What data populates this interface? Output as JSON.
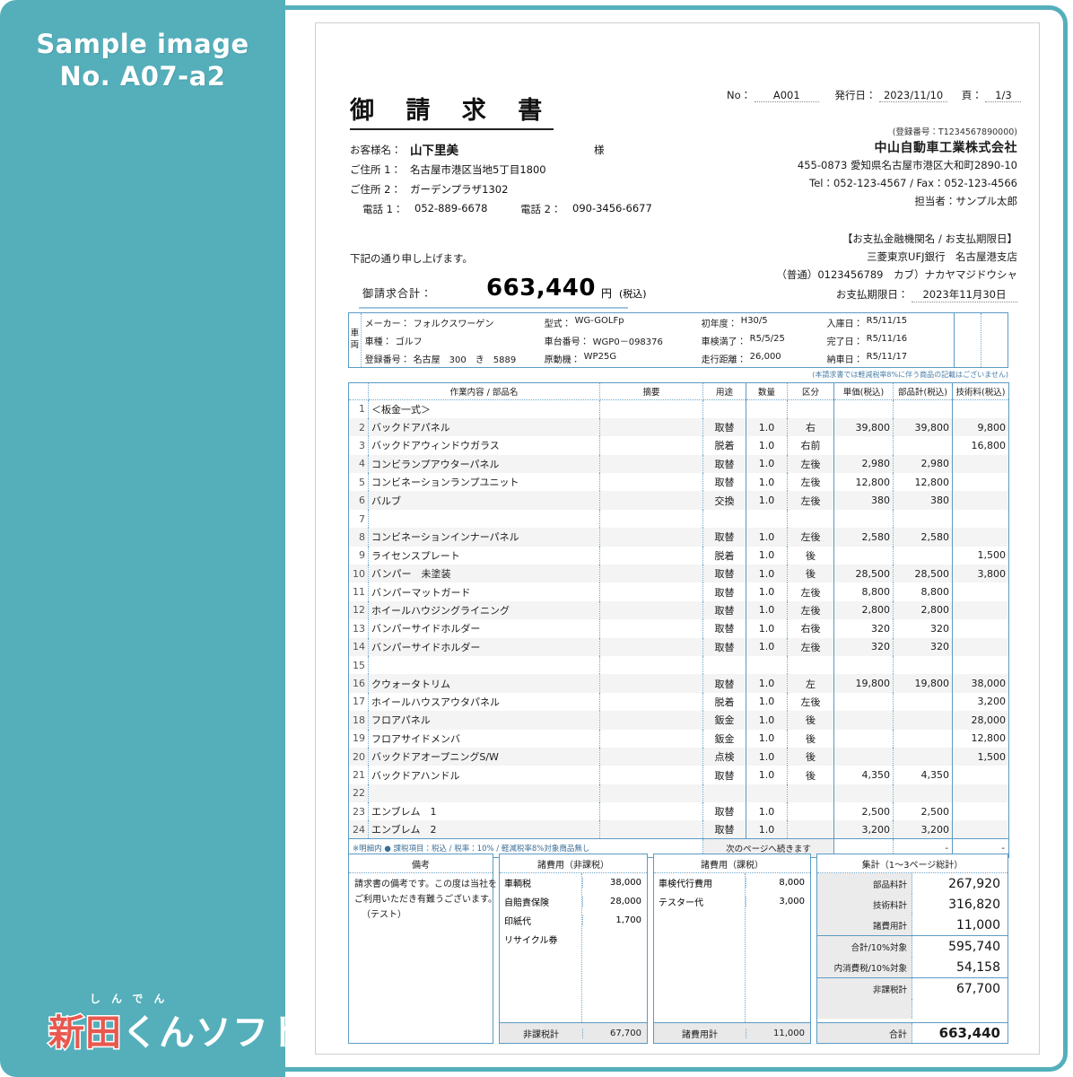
{
  "banner": {
    "title": "Sample image",
    "subtitle": "No. A07-a2",
    "logo_ruby": "しんでん",
    "logo_red": "新田",
    "logo_white": "くんソフト",
    "bg_color": "#54afbb"
  },
  "header": {
    "invoice_title": "御 請 求 書",
    "no_label": "No：",
    "no_value": "A001",
    "issue_label": "発行日：",
    "issue_value": "2023/11/10",
    "page_label": "頁：",
    "page_value": "1/3"
  },
  "customer": {
    "name_label": "お客様名：",
    "name_value": "山下里美",
    "honorific": "様",
    "addr1_label": "ご住所 1：",
    "addr1_value": "名古屋市港区当地5丁目1800",
    "addr2_label": "ご住所 2：",
    "addr2_value": "ガーデンプラザ1302",
    "tel1_label": "電話 1：",
    "tel1_value": "052-889-6678",
    "tel2_label": "電話 2：",
    "tel2_value": "090-3456-6677"
  },
  "company": {
    "registration": "(登録番号：T1234567890000)",
    "name": "中山自動車工業株式会社",
    "address": "455-0873  愛知県名古屋市港区大和町2890-10",
    "telfax": "Tel：052-123-4567  /  Fax：052-123-4566",
    "contact": "担当者：サンプル太郎"
  },
  "payment": {
    "heading": "【お支払金融機関名 / お支払期限日】",
    "bank": "三菱東京UFJ銀行　名古屋港支店",
    "account": "（普通）0123456789　カブ）ナカヤマジドウシャ",
    "due_label": "お支払期限日：",
    "due_value": "2023年11月30日"
  },
  "total": {
    "lead": "下記の通り申し上げます。",
    "label": "御請求合計：",
    "amount": "663,440",
    "yen": "円",
    "taxnote": "(税込)"
  },
  "vehicle": {
    "side_label_1": "車",
    "side_label_2": "両",
    "note": "(本請求書では軽減税率8%に伴う商品の記載はございません)",
    "fields": [
      {
        "k": "メーカー：",
        "v": "フォルクスワーゲン"
      },
      {
        "k": "型式：",
        "v": "WG-GOLFp"
      },
      {
        "k": "初年度：",
        "v": "H30/5"
      },
      {
        "k": "入庫日：",
        "v": "R5/11/15"
      },
      {
        "k": "車種：",
        "v": "ゴルフ"
      },
      {
        "k": "車台番号：",
        "v": "WGP0－098376"
      },
      {
        "k": "車検満了：",
        "v": "R5/5/25"
      },
      {
        "k": "完了日：",
        "v": "R5/11/16"
      },
      {
        "k": "登録番号：",
        "v": "名古屋　300　き　5889"
      },
      {
        "k": "原動機：",
        "v": "WP25G"
      },
      {
        "k": "走行距離：",
        "v": "26,000"
      },
      {
        "k": "納車日：",
        "v": "R5/11/17"
      }
    ]
  },
  "table": {
    "headers": [
      "",
      "作業内容 / 部品名",
      "摘要",
      "用途",
      "数量",
      "区分",
      "単価(税込)",
      "部品計(税込)",
      "技術料(税込)"
    ],
    "rows": [
      {
        "no": "1",
        "name": "＜板金一式＞",
        "remark": "",
        "use": "",
        "qty": "",
        "div": "",
        "unit": "",
        "part": "",
        "tech": ""
      },
      {
        "no": "2",
        "name": "バックドアパネル",
        "remark": "",
        "use": "取替",
        "qty": "1.0",
        "div": "右",
        "unit": "39,800",
        "part": "39,800",
        "tech": "9,800"
      },
      {
        "no": "3",
        "name": "バックドアウィンドウガラス",
        "remark": "",
        "use": "脱着",
        "qty": "1.0",
        "div": "右前",
        "unit": "",
        "part": "",
        "tech": "16,800"
      },
      {
        "no": "4",
        "name": "コンビランプアウターパネル",
        "remark": "",
        "use": "取替",
        "qty": "1.0",
        "div": "左後",
        "unit": "2,980",
        "part": "2,980",
        "tech": ""
      },
      {
        "no": "5",
        "name": "コンビネーションランプユニット",
        "remark": "",
        "use": "取替",
        "qty": "1.0",
        "div": "左後",
        "unit": "12,800",
        "part": "12,800",
        "tech": ""
      },
      {
        "no": "6",
        "name": "バルブ",
        "remark": "",
        "use": "交換",
        "qty": "1.0",
        "div": "左後",
        "unit": "380",
        "part": "380",
        "tech": ""
      },
      {
        "no": "7",
        "name": "",
        "remark": "",
        "use": "",
        "qty": "",
        "div": "",
        "unit": "",
        "part": "",
        "tech": ""
      },
      {
        "no": "8",
        "name": "コンビネーションインナーパネル",
        "remark": "",
        "use": "取替",
        "qty": "1.0",
        "div": "左後",
        "unit": "2,580",
        "part": "2,580",
        "tech": ""
      },
      {
        "no": "9",
        "name": "ライセンスプレート",
        "remark": "",
        "use": "脱着",
        "qty": "1.0",
        "div": "後",
        "unit": "",
        "part": "",
        "tech": "1,500"
      },
      {
        "no": "10",
        "name": "バンパー　未塗装",
        "remark": "",
        "use": "取替",
        "qty": "1.0",
        "div": "後",
        "unit": "28,500",
        "part": "28,500",
        "tech": "3,800"
      },
      {
        "no": "11",
        "name": "バンパーマットガード",
        "remark": "",
        "use": "取替",
        "qty": "1.0",
        "div": "左後",
        "unit": "8,800",
        "part": "8,800",
        "tech": ""
      },
      {
        "no": "12",
        "name": "ホイールハウジングライニング",
        "remark": "",
        "use": "取替",
        "qty": "1.0",
        "div": "左後",
        "unit": "2,800",
        "part": "2,800",
        "tech": ""
      },
      {
        "no": "13",
        "name": "バンパーサイドホルダー",
        "remark": "",
        "use": "取替",
        "qty": "1.0",
        "div": "右後",
        "unit": "320",
        "part": "320",
        "tech": ""
      },
      {
        "no": "14",
        "name": "バンパーサイドホルダー",
        "remark": "",
        "use": "取替",
        "qty": "1.0",
        "div": "左後",
        "unit": "320",
        "part": "320",
        "tech": ""
      },
      {
        "no": "15",
        "name": "",
        "remark": "",
        "use": "",
        "qty": "",
        "div": "",
        "unit": "",
        "part": "",
        "tech": ""
      },
      {
        "no": "16",
        "name": "クウォータトリム",
        "remark": "",
        "use": "取替",
        "qty": "1.0",
        "div": "左",
        "unit": "19,800",
        "part": "19,800",
        "tech": "38,000"
      },
      {
        "no": "17",
        "name": "ホイールハウスアウタパネル",
        "remark": "",
        "use": "脱着",
        "qty": "1.0",
        "div": "左後",
        "unit": "",
        "part": "",
        "tech": "3,200"
      },
      {
        "no": "18",
        "name": "フロアパネル",
        "remark": "",
        "use": "鈑金",
        "qty": "1.0",
        "div": "後",
        "unit": "",
        "part": "",
        "tech": "28,000"
      },
      {
        "no": "19",
        "name": "フロアサイドメンバ",
        "remark": "",
        "use": "鈑金",
        "qty": "1.0",
        "div": "後",
        "unit": "",
        "part": "",
        "tech": "12,800"
      },
      {
        "no": "20",
        "name": "バックドアオープニングS/W",
        "remark": "",
        "use": "点検",
        "qty": "1.0",
        "div": "後",
        "unit": "",
        "part": "",
        "tech": "1,500"
      },
      {
        "no": "21",
        "name": "バックドアハンドル",
        "remark": "",
        "use": "取替",
        "qty": "1.0",
        "div": "後",
        "unit": "4,350",
        "part": "4,350",
        "tech": ""
      },
      {
        "no": "22",
        "name": "",
        "remark": "",
        "use": "",
        "qty": "",
        "div": "",
        "unit": "",
        "part": "",
        "tech": ""
      },
      {
        "no": "23",
        "name": "エンブレム　1",
        "remark": "",
        "use": "取替",
        "qty": "1.0",
        "div": "",
        "unit": "2,500",
        "part": "2,500",
        "tech": ""
      },
      {
        "no": "24",
        "name": "エンブレム　2",
        "remark": "",
        "use": "取替",
        "qty": "1.0",
        "div": "",
        "unit": "3,200",
        "part": "3,200",
        "tech": ""
      }
    ],
    "footer_note": "※明細内 ● 課税項目：税込 / 税率：10% / 軽減税率8%対象商品無し",
    "footer_continue": "次のページへ続きます",
    "footer_part_total": "-",
    "footer_tech_total": "-"
  },
  "remarks_box": {
    "title": "備考",
    "lines": [
      "請求書の備考です。この度は当社を",
      "ご利用いただき有難うございます。",
      "（テスト）"
    ]
  },
  "nontax_box": {
    "title": "諸費用（非課税）",
    "rows": [
      {
        "name": "車輌税",
        "amount": "38,000"
      },
      {
        "name": "自賠責保険",
        "amount": "28,000"
      },
      {
        "name": "印紙代",
        "amount": "1,700"
      },
      {
        "name": "リサイクル券",
        "amount": ""
      }
    ],
    "total_label": "非課税計",
    "total_amount": "67,700"
  },
  "tax_box": {
    "title": "諸費用（課税）",
    "rows": [
      {
        "name": "車検代行費用",
        "amount": "8,000"
      },
      {
        "name": "テスター代",
        "amount": "3,000"
      }
    ],
    "total_label": "諸費用計",
    "total_amount": "11,000"
  },
  "summary_box": {
    "title": "集計（1～3ページ総計）",
    "group1": [
      {
        "label": "部品料計",
        "value": "267,920"
      },
      {
        "label": "技術料計",
        "value": "316,820"
      },
      {
        "label": "諸費用計",
        "value": "11,000"
      }
    ],
    "group2": [
      {
        "label": "合計/10%対象",
        "value": "595,740"
      },
      {
        "label": "内消費税/10%対象",
        "value": "54,158"
      }
    ],
    "group3": [
      {
        "label": "非課税計",
        "value": "67,700"
      }
    ],
    "total_label": "合計",
    "total_value": "663,440"
  }
}
